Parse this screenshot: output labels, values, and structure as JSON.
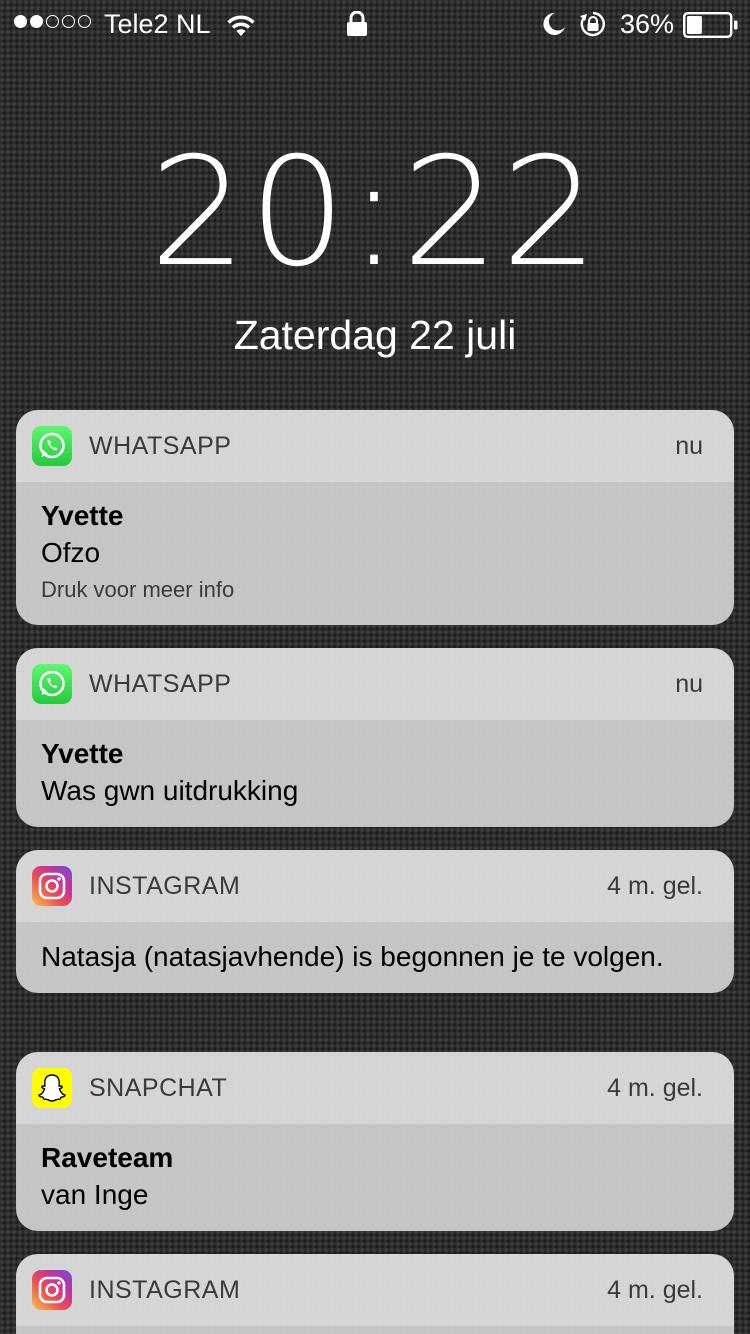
{
  "status_bar": {
    "signal_full_dots": 2,
    "signal_empty_dots": 3,
    "carrier": "Tele2 NL",
    "battery_percent": "36%",
    "battery_level": 0.36,
    "icons": [
      "wifi-icon",
      "lock-icon",
      "moon-icon",
      "orientation-lock-icon",
      "battery-icon"
    ]
  },
  "lockscreen": {
    "time": "20:22",
    "date": "Zaterdag 22 juli"
  },
  "notifications": [
    {
      "app": "WHATSAPP",
      "icon": "whatsapp-icon",
      "time": "nu",
      "sender": "Yvette",
      "message": "Ofzo",
      "hint": "Druk voor meer info"
    },
    {
      "app": "WHATSAPP",
      "icon": "whatsapp-icon",
      "time": "nu",
      "sender": "Yvette",
      "message": "Was gwn uitdrukking"
    },
    {
      "app": "INSTAGRAM",
      "icon": "instagram-icon",
      "time": "4 m. gel.",
      "message": "Natasja (natasjavhende) is begonnen je te volgen."
    },
    {
      "app": "SNAPCHAT",
      "icon": "snapchat-icon",
      "time": "4 m. gel.",
      "sender": "Raveteam",
      "message": "van Inge"
    },
    {
      "app": "INSTAGRAM",
      "icon": "instagram-icon",
      "time": "4 m. gel."
    }
  ],
  "colors": {
    "whatsapp": "#25D366",
    "snapchat": "#FFFC00",
    "notification_header": "#DEDEDE",
    "notification_body": "#CDCDCD"
  }
}
